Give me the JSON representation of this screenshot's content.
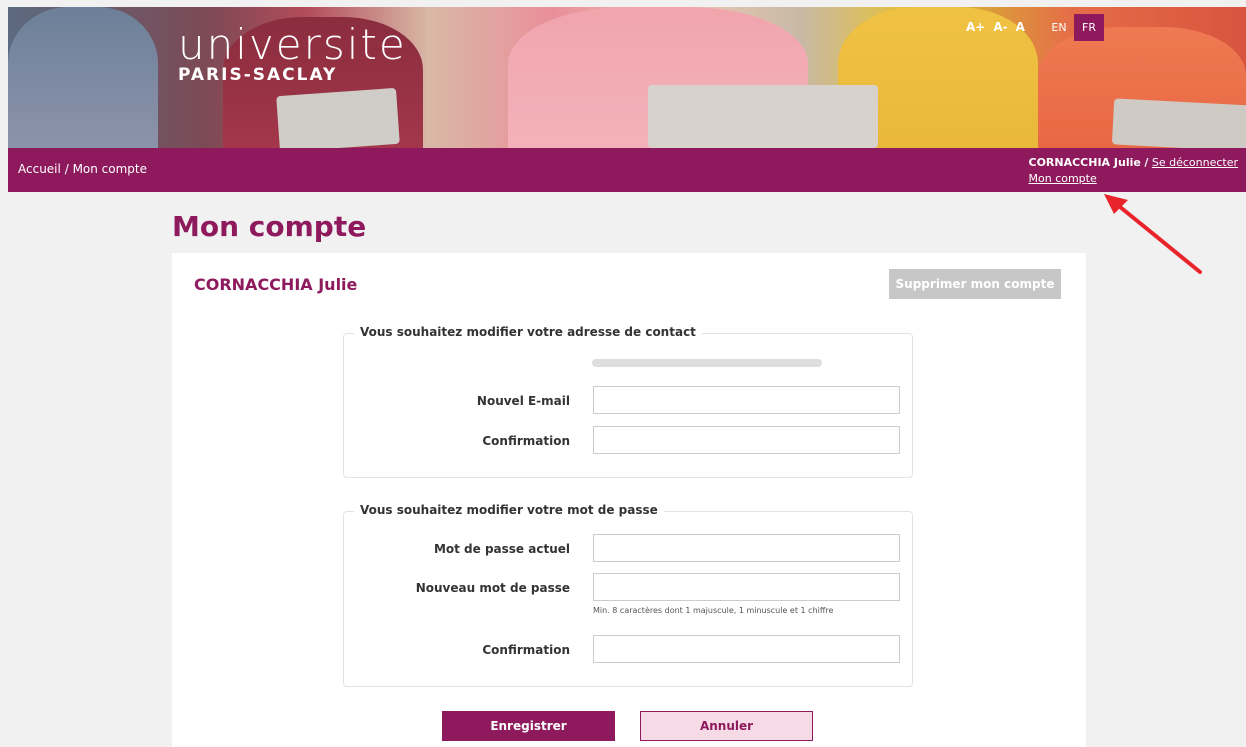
{
  "header": {
    "logo_line1": "universite",
    "logo_line2": "PARIS-SACLAY",
    "font_sizes": [
      "A+",
      "A-",
      "A"
    ],
    "languages": [
      "EN",
      "FR"
    ],
    "active_language": "FR"
  },
  "nav": {
    "breadcrumb_home": "Accueil",
    "breadcrumb_sep": "/",
    "breadcrumb_current": "Mon compte",
    "user_name": "CORNACCHIA Julie",
    "user_sep": "/",
    "logout": "Se déconnecter",
    "account_link": "Mon compte"
  },
  "page": {
    "title": "Mon compte",
    "account_name": "CORNACCHIA Julie",
    "delete_button": "Supprimer mon compte"
  },
  "email_section": {
    "legend": "Vous souhaitez modifier votre adresse de contact",
    "new_email_label": "Nouvel E-mail",
    "confirm_label": "Confirmation"
  },
  "password_section": {
    "legend": "Vous souhaitez modifier votre mot de passe",
    "current_label": "Mot de passe actuel",
    "new_label": "Nouveau mot de passe",
    "hint": "Min. 8 caractères dont 1 majuscule, 1 minuscule et 1 chiffre",
    "confirm_label": "Confirmation"
  },
  "actions": {
    "save": "Enregistrer",
    "cancel": "Annuler"
  },
  "colors": {
    "brand": "#8e1a5d",
    "background": "#f1f1f1",
    "annotation_arrow": "#e8232a"
  }
}
